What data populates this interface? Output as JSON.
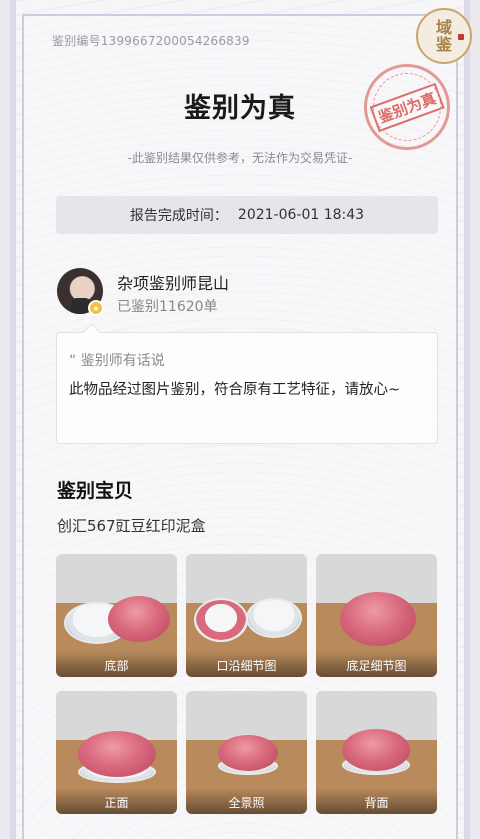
{
  "header": {
    "serial": "鉴别编号1399667200054266839",
    "logo_line1": "域",
    "logo_line2": "鉴",
    "title": "鉴别为真",
    "stamp": "鉴别为真",
    "disclaimer": "-此鉴别结果仅供参考，无法作为交易凭证-"
  },
  "report": {
    "time_label": "报告完成时间：",
    "time_value": "2021-06-01 18:43"
  },
  "appraiser": {
    "name": "杂项鉴别师昆山",
    "count": "已鉴别11620单",
    "message_label": "“ 鉴别师有话说",
    "message": "此物品经过图片鉴别，符合原有工艺特征，请放心~"
  },
  "item": {
    "section_title": "鉴别宝贝",
    "name": "创汇567豇豆红印泥盒",
    "photos": [
      {
        "caption": "底部"
      },
      {
        "caption": "口沿细节图"
      },
      {
        "caption": "底足细节图"
      },
      {
        "caption": "正面"
      },
      {
        "caption": "全景照"
      },
      {
        "caption": "背面"
      }
    ]
  },
  "colors": {
    "accent_red": "#d9534f",
    "glaze": "#d96a7e",
    "logo_gold": "#a8824a"
  }
}
